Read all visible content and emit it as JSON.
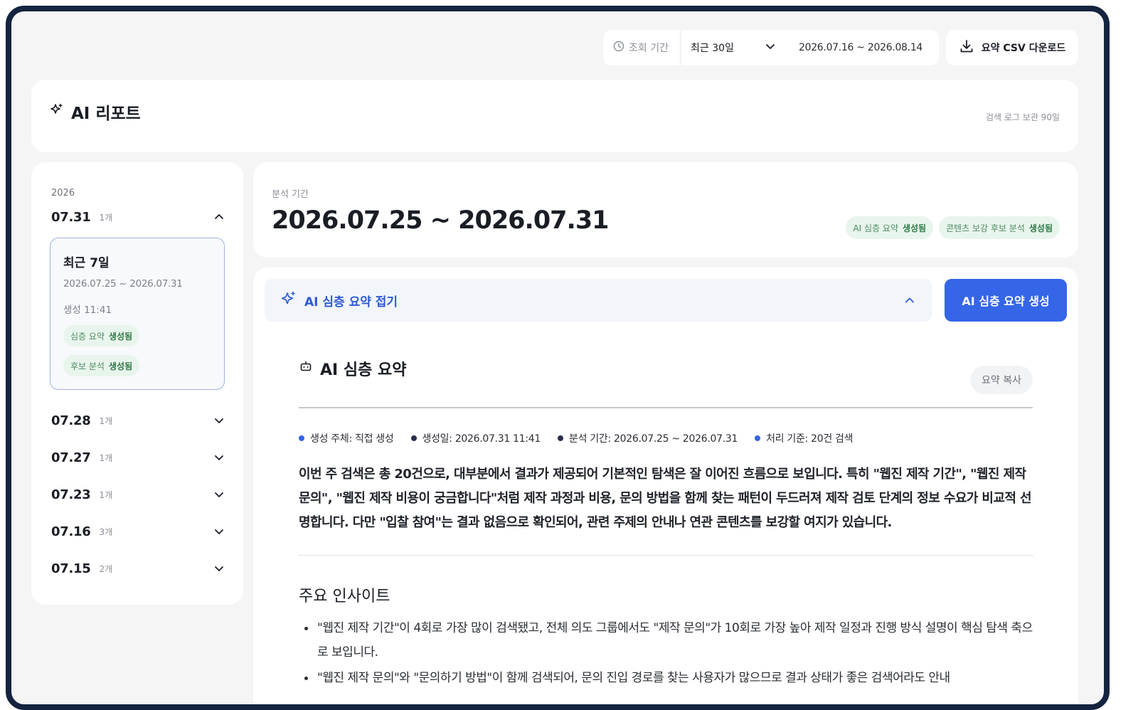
{
  "topbar": {
    "period_label": "조회 기간",
    "period_select": "최근 30일",
    "period_range": "2026.07.16 ~ 2026.08.14",
    "csv_button": "요약 CSV 다운로드"
  },
  "header": {
    "title": "AI 리포트",
    "retention": "검색 로그 보관 90일"
  },
  "sidebar": {
    "year": "2026",
    "dates": [
      {
        "date": "07.31",
        "count": "1개"
      },
      {
        "date": "07.28",
        "count": "1개"
      },
      {
        "date": "07.27",
        "count": "1개"
      },
      {
        "date": "07.23",
        "count": "1개"
      },
      {
        "date": "07.16",
        "count": "3개"
      },
      {
        "date": "07.15",
        "count": "2개"
      }
    ],
    "report": {
      "title": "최근 7일",
      "range": "2026.07.25 ~ 2026.07.31",
      "time": "생성 11:41",
      "chips": [
        {
          "label": "심층 요약",
          "status": "생성됨"
        },
        {
          "label": "후보 분석",
          "status": "생성됨"
        }
      ]
    }
  },
  "period": {
    "label": "분석 기간",
    "range": "2026.07.25 ~ 2026.07.31",
    "badges": [
      {
        "label": "AI 심층 요약",
        "status": "생성됨"
      },
      {
        "label": "콘텐츠 보강 후보 분석",
        "status": "생성됨"
      }
    ]
  },
  "main": {
    "toggle_label": "AI 심층 요약 접기",
    "generate_button": "AI 심층 요약 생성",
    "summary_title": "AI 심층 요약",
    "copy_button": "요약 복사",
    "meta": [
      {
        "text": "생성 주체: 직접 생성",
        "color": "#3566e8"
      },
      {
        "text": "생성일: 2026.07.31 11:41",
        "color": "#2a2d4a"
      },
      {
        "text": "분석 기간: 2026.07.25 ~ 2026.07.31",
        "color": "#2a2d4a"
      },
      {
        "text": "처리 기준: 20건 검색",
        "color": "#3566e8"
      }
    ],
    "summary_text": "이번 주 검색은 총 20건으로, 대부분에서 결과가 제공되어 기본적인 탐색은 잘 이어진 흐름으로 보입니다. 특히 \"웹진 제작 기간\", \"웹진 제작 문의\", \"웹진 제작 비용이 궁금합니다\"처럼 제작 과정과 비용, 문의 방법을 함께 찾는 패턴이 두드러져 제작 검토 단계의 정보 수요가 비교적 선명합니다. 다만 \"입찰 참여\"는 결과 없음으로 확인되어, 관련 주제의 안내나 연관 콘텐츠를 보강할 여지가 있습니다.",
    "insights_title": "주요 인사이트",
    "insights": [
      "\"웹진 제작 기간\"이 4회로 가장 많이 검색됐고, 전체 의도 그룹에서도 \"제작 문의\"가 10회로 가장 높아 제작 일정과 진행 방식 설명이 핵심 탐색 축으로 보입니다.",
      "\"웹진 제작 문의\"와 \"문의하기 방법\"이 함께 검색되어, 문의 진입 경로를 찾는 사용자가 많으므로 결과 상태가 좋은 검색어라도 안내"
    ]
  }
}
